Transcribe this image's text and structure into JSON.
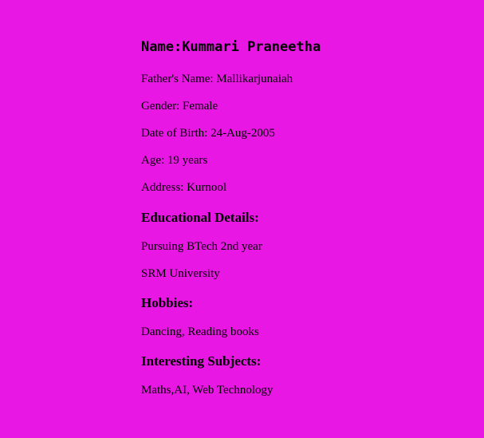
{
  "profile": {
    "name_label": "Name:",
    "name_value": "Kummari Praneetha",
    "father": "Father's Name: Mallikarjunaiah",
    "gender": "Gender: Female",
    "dob": "Date of Birth: 24-Aug-2005",
    "age": "Age: 19 years",
    "address": "Address: Kurnool"
  },
  "education": {
    "heading": "Educational Details:",
    "course": "Pursuing BTech 2nd year",
    "university": "SRM University"
  },
  "hobbies": {
    "heading": "Hobbies:",
    "list": "Dancing, Reading books"
  },
  "subjects": {
    "heading": "Interesting Subjects:",
    "list": "Maths,AI, Web Technology"
  },
  "colors": {
    "background": "#e817e4",
    "text": "#000000"
  }
}
